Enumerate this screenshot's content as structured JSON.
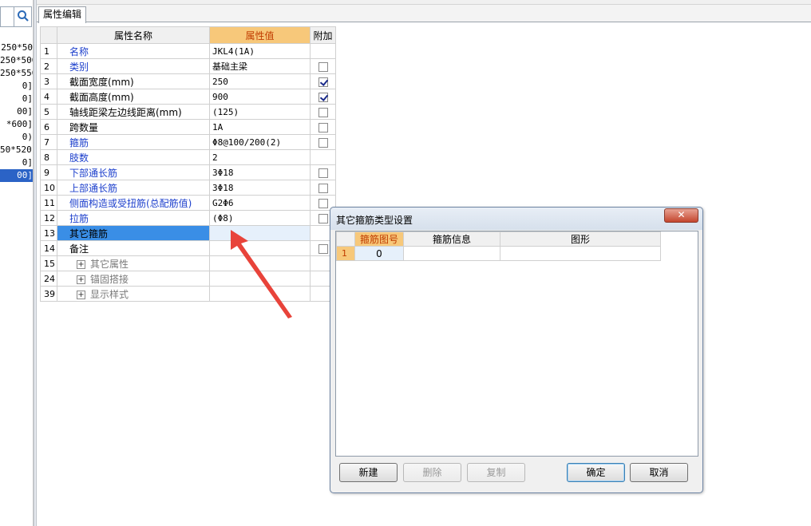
{
  "left_panel": {
    "items": [
      "250*50",
      "250*500",
      "250*550",
      "0]",
      "0]",
      "00]",
      "*600]",
      "0)",
      "50*520]",
      "0]",
      "00]"
    ],
    "selected_index": 10
  },
  "tab": {
    "label": "属性编辑"
  },
  "grid": {
    "headers": {
      "name": "属性名称",
      "value": "属性值",
      "extra": "附加"
    },
    "rows": [
      {
        "num": "1",
        "name": "名称",
        "value": "JKL4(1A)",
        "color": "blue",
        "check": null
      },
      {
        "num": "2",
        "name": "类别",
        "value": "基础主梁",
        "color": "blue",
        "check": false
      },
      {
        "num": "3",
        "name": "截面宽度(mm)",
        "value": "250",
        "color": "black",
        "check": true
      },
      {
        "num": "4",
        "name": "截面高度(mm)",
        "value": "900",
        "color": "black",
        "check": true
      },
      {
        "num": "5",
        "name": "轴线距梁左边线距离(mm)",
        "value": "(125)",
        "color": "black",
        "check": false
      },
      {
        "num": "6",
        "name": "跨数量",
        "value": "1A",
        "color": "black",
        "check": false
      },
      {
        "num": "7",
        "name": "箍筋",
        "value": "Φ8@100/200(2)",
        "color": "blue",
        "check": false
      },
      {
        "num": "8",
        "name": "肢数",
        "value": "2",
        "color": "blue",
        "check": null
      },
      {
        "num": "9",
        "name": "下部通长筋",
        "value": "3Φ18",
        "color": "blue",
        "check": false
      },
      {
        "num": "10",
        "name": "上部通长筋",
        "value": "3Φ18",
        "color": "blue",
        "check": false
      },
      {
        "num": "11",
        "name": "侧面构造或受扭筋(总配筋值)",
        "value": "G2Φ6",
        "color": "blue",
        "check": false
      },
      {
        "num": "12",
        "name": "拉筋",
        "value": "(Φ8)",
        "color": "blue",
        "check": false
      },
      {
        "num": "13",
        "name": "其它箍筋",
        "value": "",
        "color": "black",
        "check": null,
        "selected": true
      },
      {
        "num": "14",
        "name": "备注",
        "value": "",
        "color": "black",
        "check": false
      }
    ],
    "groups": [
      {
        "num": "15",
        "name": "其它属性"
      },
      {
        "num": "24",
        "name": "锚固搭接"
      },
      {
        "num": "39",
        "name": "显示样式"
      }
    ]
  },
  "dialog": {
    "title": "其它箍筋类型设置",
    "close_label": "✕",
    "columns": [
      "箍筋图号",
      "箍筋信息",
      "图形"
    ],
    "rows": [
      {
        "num": "1",
        "code": "0",
        "info": "",
        "shape": ""
      }
    ],
    "buttons": {
      "new": "新建",
      "delete": "删除",
      "copy": "复制",
      "ok": "确定",
      "cancel": "取消"
    }
  },
  "colors": {
    "accent_orange": "#f7c87a",
    "selection_blue": "#3a8ee6",
    "name_blue": "#1c3fcc",
    "arrow_red": "#e8433a"
  },
  "icons": {
    "search": "search-icon",
    "expand": "plus-box-icon",
    "arrow": "red-arrow-annotation"
  }
}
